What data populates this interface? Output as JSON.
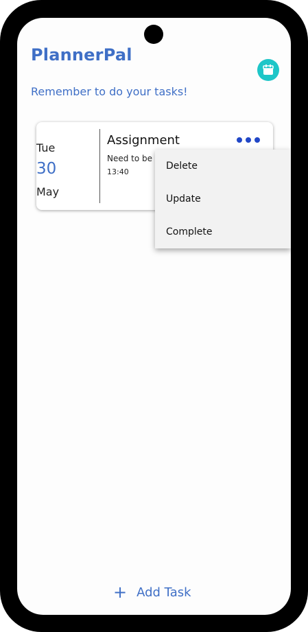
{
  "app": {
    "title": "PlannerPal",
    "subtitle": "Remember to do your tasks!",
    "calendar_icon": "calendar-icon",
    "accent_color": "#3f6fc6",
    "calendar_button_color": "#1ec6c8"
  },
  "task": {
    "weekday": "Tue",
    "day": "30",
    "month": "May",
    "title": "Assignment",
    "description": "Need to be dor",
    "time": "13:40",
    "more_icon": "more-horizontal-icon"
  },
  "menu": {
    "items": [
      {
        "label": "Delete"
      },
      {
        "label": "Update"
      },
      {
        "label": "Complete"
      }
    ]
  },
  "footer": {
    "add_icon": "plus-icon",
    "add_label": "Add Task"
  }
}
